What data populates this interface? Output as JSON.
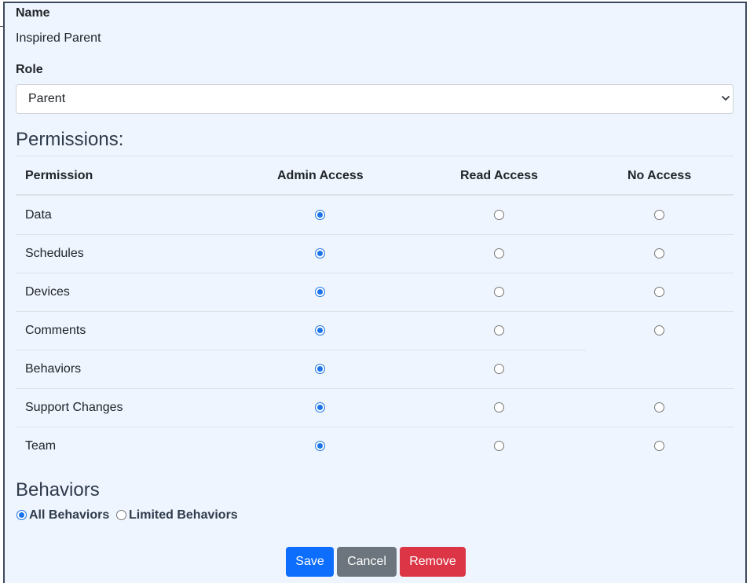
{
  "form": {
    "name_label": "Name",
    "name_value": "Inspired Parent",
    "role_label": "Role",
    "role_value": "Parent"
  },
  "permissions": {
    "heading": "Permissions:",
    "columns": [
      "Permission",
      "Admin Access",
      "Read Access",
      "No Access"
    ],
    "rows": [
      {
        "label": "Data",
        "selected": "Admin Access"
      },
      {
        "label": "Schedules",
        "selected": "Admin Access"
      },
      {
        "label": "Devices",
        "selected": "Admin Access"
      },
      {
        "label": "Comments",
        "selected": "Admin Access"
      },
      {
        "label": "Behaviors",
        "selected": "Admin Access"
      },
      {
        "label": "Support Changes",
        "selected": "Admin Access"
      },
      {
        "label": "Team",
        "selected": "Admin Access"
      }
    ]
  },
  "behaviors": {
    "heading": "Behaviors",
    "options": [
      {
        "label": "All Behaviors",
        "selected": true
      },
      {
        "label": "Limited Behaviors",
        "selected": false
      }
    ]
  },
  "actions": {
    "save_label": "Save",
    "cancel_label": "Cancel",
    "remove_label": "Remove"
  },
  "colors": {
    "panel_bg": "#eef5fe",
    "primary": "#0d6efd",
    "secondary": "#6c757d",
    "danger": "#dc3545",
    "radio_checked": "#1a73e8"
  }
}
